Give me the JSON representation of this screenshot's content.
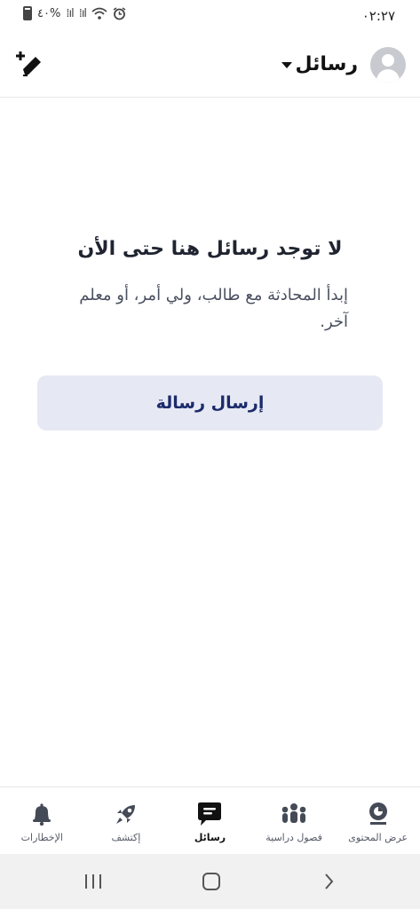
{
  "status_bar": {
    "time": "٠٢:٢٧",
    "battery_text": "٤٠%",
    "icons": [
      "battery-icon",
      "signal-icon",
      "signal-icon",
      "wifi-icon",
      "alarm-icon"
    ]
  },
  "header": {
    "title": "رسائل",
    "avatar_icon": "user-avatar-icon",
    "compose_icon": "compose-message-icon",
    "dropdown_icon": "caret-down-icon"
  },
  "empty_state": {
    "title": "لا توجد رسائل هنا حتى الأن",
    "subtitle": "إبدأ المحادثة مع طالب، ولي أمر، أو معلم آخر.",
    "button_label": "إرسال رسالة"
  },
  "bottom_nav": {
    "items": [
      {
        "label": "عرض المحتوى",
        "icon": "content-icon",
        "active": false
      },
      {
        "label": "فصول دراسية",
        "icon": "classes-icon",
        "active": false
      },
      {
        "label": "رسائل",
        "icon": "messages-icon",
        "active": true
      },
      {
        "label": "إكتشف",
        "icon": "rocket-icon",
        "active": false
      },
      {
        "label": "الإخطارات",
        "icon": "bell-icon",
        "active": false
      }
    ]
  },
  "system_nav": {
    "icons": [
      "recents-icon",
      "home-icon",
      "back-icon"
    ]
  },
  "colors": {
    "button_bg": "#e6e9f4",
    "button_text": "#1c2b6b",
    "avatar": "#c9cacf",
    "system_nav_bg": "#f1f1f1"
  }
}
